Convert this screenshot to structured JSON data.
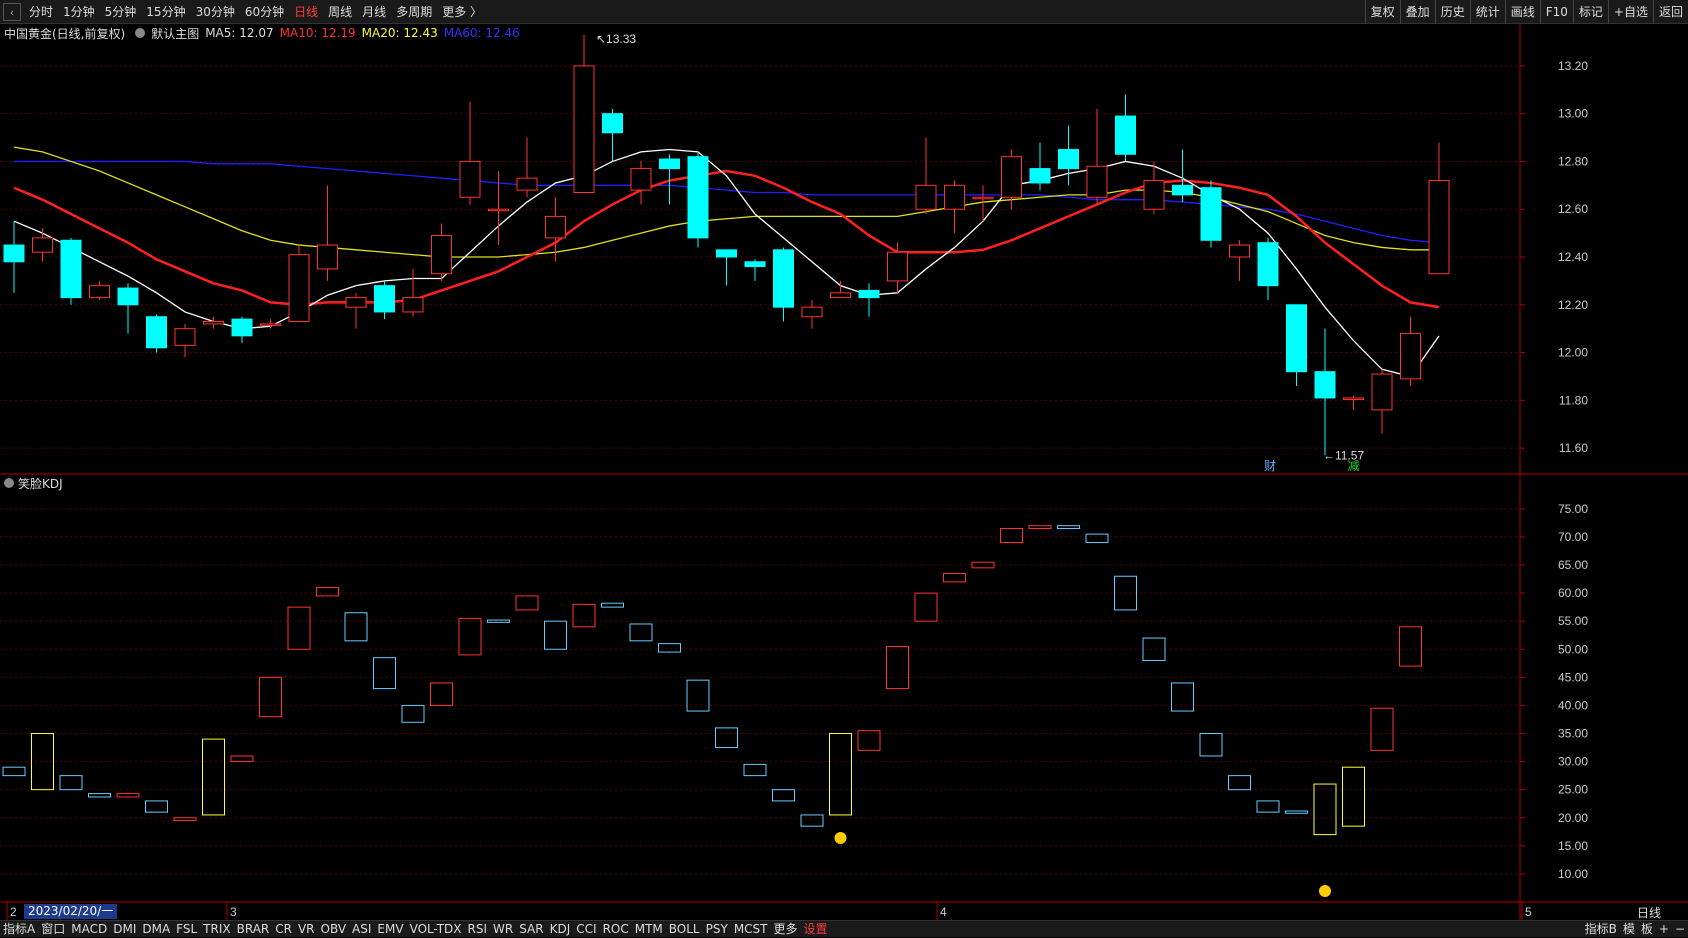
{
  "toolbar": {
    "back_icon": "back-arrow-icon",
    "periods": [
      "分时",
      "1分钟",
      "5分钟",
      "15分钟",
      "30分钟",
      "60分钟",
      "日线",
      "周线",
      "月线",
      "多周期",
      "更多 〉"
    ],
    "active_period": "日线",
    "right_buttons": [
      "复权",
      "叠加",
      "历史",
      "统计",
      "画线",
      "F10",
      "标记",
      "+自选",
      "返回"
    ]
  },
  "main_chart": {
    "title": "中国黄金(日线,前复权)",
    "template": "默认主图",
    "ma5": "MA5: 12.07",
    "ma10": "MA10: 12.19",
    "ma20": "MA20: 12.43",
    "ma60": "MA60: 12.46",
    "high_label": "13.33",
    "low_label": "11.57",
    "event_labels": [
      "财",
      "减"
    ]
  },
  "sub_chart": {
    "title": "笑脸KDJ"
  },
  "colors": {
    "up": "#ff3333",
    "down": "#00ffff",
    "ma5": "#ffffff",
    "ma10": "#ff2020",
    "ma20": "#e0e020",
    "ma60": "#2020ff",
    "yellow_box": "#ffff33",
    "blue_box": "#66ccff",
    "grid": "#8b0000"
  },
  "chart_data": [
    {
      "type": "candlestick",
      "title": "中国黄金(日线,前复权)",
      "ylim": [
        11.5,
        13.3
      ],
      "y_ticks": [
        "13.20",
        "13.00",
        "12.80",
        "12.60",
        "12.40",
        "12.20",
        "12.00",
        "11.80",
        "11.60"
      ],
      "x_labels": [
        "2",
        "3",
        "4",
        "5"
      ],
      "cursor_date": "2023/02/20/一",
      "candles": [
        [
          12.45,
          12.38,
          12.55,
          12.25
        ],
        [
          12.42,
          12.48,
          12.52,
          12.38
        ],
        [
          12.47,
          12.23,
          12.48,
          12.2
        ],
        [
          12.23,
          12.28,
          12.3,
          12.22
        ],
        [
          12.27,
          12.2,
          12.29,
          12.08
        ],
        [
          12.15,
          12.02,
          12.16,
          12.0
        ],
        [
          12.03,
          12.1,
          12.12,
          11.98
        ],
        [
          12.12,
          12.13,
          12.15,
          12.1
        ],
        [
          12.14,
          12.07,
          12.15,
          12.04
        ],
        [
          12.12,
          12.12,
          12.14,
          12.1
        ],
        [
          12.13,
          12.41,
          12.45,
          12.13
        ],
        [
          12.35,
          12.45,
          12.7,
          12.3
        ],
        [
          12.19,
          12.23,
          12.25,
          12.1
        ],
        [
          12.28,
          12.17,
          12.3,
          12.14
        ],
        [
          12.17,
          12.23,
          12.35,
          12.15
        ],
        [
          12.33,
          12.49,
          12.54,
          12.3
        ],
        [
          12.65,
          12.8,
          13.05,
          12.62
        ],
        [
          12.6,
          12.6,
          12.76,
          12.45
        ],
        [
          12.68,
          12.73,
          12.9,
          12.65
        ],
        [
          12.48,
          12.57,
          12.65,
          12.38
        ],
        [
          12.67,
          13.2,
          13.33,
          12.67
        ],
        [
          13.0,
          12.92,
          13.02,
          12.8
        ],
        [
          12.68,
          12.77,
          12.8,
          12.62
        ],
        [
          12.81,
          12.77,
          12.83,
          12.62
        ],
        [
          12.82,
          12.48,
          12.84,
          12.44
        ],
        [
          12.43,
          12.4,
          12.42,
          12.28
        ],
        [
          12.38,
          12.36,
          12.39,
          12.3
        ],
        [
          12.43,
          12.19,
          12.44,
          12.13
        ],
        [
          12.15,
          12.19,
          12.22,
          12.1
        ],
        [
          12.23,
          12.25,
          12.3,
          12.23
        ],
        [
          12.26,
          12.23,
          12.29,
          12.15
        ],
        [
          12.3,
          12.42,
          12.46,
          12.25
        ],
        [
          12.6,
          12.7,
          12.9,
          12.58
        ],
        [
          12.6,
          12.7,
          12.72,
          12.5
        ],
        [
          12.65,
          12.65,
          12.7,
          12.55
        ],
        [
          12.65,
          12.82,
          12.85,
          12.6
        ],
        [
          12.77,
          12.71,
          12.88,
          12.68
        ],
        [
          12.85,
          12.77,
          12.95,
          12.7
        ],
        [
          12.65,
          12.78,
          13.02,
          12.62
        ],
        [
          12.99,
          12.83,
          13.08,
          12.8
        ],
        [
          12.6,
          12.72,
          12.8,
          12.58
        ],
        [
          12.7,
          12.66,
          12.85,
          12.63
        ],
        [
          12.69,
          12.47,
          12.72,
          12.44
        ],
        [
          12.4,
          12.45,
          12.47,
          12.3
        ],
        [
          12.46,
          12.28,
          12.48,
          12.22
        ],
        [
          12.2,
          11.92,
          12.2,
          11.86
        ],
        [
          11.92,
          11.81,
          12.1,
          11.57
        ],
        [
          11.81,
          11.81,
          11.82,
          11.76
        ],
        [
          11.76,
          11.91,
          11.93,
          11.66
        ],
        [
          11.89,
          12.08,
          12.15,
          11.86
        ],
        [
          12.33,
          12.72,
          12.88,
          12.33
        ]
      ],
      "series": [
        {
          "name": "MA5",
          "values": [
            12.55,
            12.5,
            12.44,
            12.38,
            12.32,
            12.25,
            12.17,
            12.13,
            12.1,
            12.11,
            12.17,
            12.24,
            12.28,
            12.3,
            12.31,
            12.31,
            12.42,
            12.53,
            12.63,
            12.71,
            12.74,
            12.8,
            12.84,
            12.85,
            12.84,
            12.74,
            12.58,
            12.48,
            12.38,
            12.28,
            12.24,
            12.25,
            12.35,
            12.44,
            12.55,
            12.7,
            12.72,
            12.75,
            12.77,
            12.8,
            12.78,
            12.73,
            12.66,
            12.6,
            12.5,
            12.35,
            12.19,
            12.05,
            11.93,
            11.9,
            12.07
          ]
        },
        {
          "name": "MA10",
          "values": [
            12.69,
            12.64,
            12.58,
            12.52,
            12.46,
            12.39,
            12.34,
            12.29,
            12.26,
            12.21,
            12.2,
            12.21,
            12.21,
            12.21,
            12.22,
            12.26,
            12.3,
            12.34,
            12.4,
            12.46,
            12.55,
            12.62,
            12.68,
            12.72,
            12.74,
            12.76,
            12.74,
            12.69,
            12.63,
            12.58,
            12.49,
            12.42,
            12.42,
            12.42,
            12.43,
            12.47,
            12.52,
            12.57,
            12.62,
            12.67,
            12.71,
            12.72,
            12.71,
            12.69,
            12.66,
            12.57,
            12.46,
            12.37,
            12.28,
            12.21,
            12.19
          ]
        },
        {
          "name": "MA20",
          "values": [
            12.86,
            12.84,
            12.8,
            12.76,
            12.71,
            12.66,
            12.61,
            12.56,
            12.51,
            12.47,
            12.45,
            12.44,
            12.43,
            12.42,
            12.41,
            12.4,
            12.4,
            12.4,
            12.41,
            12.42,
            12.44,
            12.47,
            12.5,
            12.53,
            12.55,
            12.56,
            12.57,
            12.57,
            12.57,
            12.57,
            12.57,
            12.57,
            12.59,
            12.61,
            12.63,
            12.64,
            12.65,
            12.66,
            12.66,
            12.68,
            12.68,
            12.67,
            12.65,
            12.62,
            12.59,
            12.54,
            12.49,
            12.46,
            12.44,
            12.43,
            12.43
          ]
        },
        {
          "name": "MA60",
          "values": [
            12.8,
            12.8,
            12.8,
            12.8,
            12.8,
            12.8,
            12.8,
            12.79,
            12.79,
            12.79,
            12.78,
            12.77,
            12.76,
            12.75,
            12.74,
            12.73,
            12.72,
            12.71,
            12.7,
            12.7,
            12.7,
            12.7,
            12.7,
            12.7,
            12.69,
            12.68,
            12.67,
            12.67,
            12.66,
            12.66,
            12.66,
            12.66,
            12.66,
            12.66,
            12.66,
            12.66,
            12.66,
            12.65,
            12.64,
            12.64,
            12.64,
            12.63,
            12.62,
            12.61,
            12.6,
            12.58,
            12.55,
            12.52,
            12.49,
            12.47,
            12.46
          ]
        }
      ]
    },
    {
      "type": "bar",
      "title": "笑脸KDJ",
      "ylim": [
        5,
        78
      ],
      "y_ticks": [
        "75.00",
        "70.00",
        "65.00",
        "60.00",
        "55.00",
        "50.00",
        "45.00",
        "40.00",
        "35.00",
        "30.00",
        "25.00",
        "20.00",
        "15.00",
        "10.00"
      ],
      "boxes": [
        [
          27.5,
          29.0,
          "b"
        ],
        [
          25,
          35,
          "y"
        ],
        [
          25,
          27.5,
          "b"
        ],
        [
          23.7,
          24.3,
          "b"
        ],
        [
          23.7,
          24.3,
          "r"
        ],
        [
          21,
          23,
          "b"
        ],
        [
          19.5,
          20,
          "r"
        ],
        [
          20.5,
          34,
          "y"
        ],
        [
          30,
          31,
          "r"
        ],
        [
          38,
          45,
          "r"
        ],
        [
          50,
          57.5,
          "r"
        ],
        [
          59.5,
          61,
          "r"
        ],
        [
          51.5,
          56.5,
          "b"
        ],
        [
          43,
          48.5,
          "b"
        ],
        [
          37,
          40,
          "b"
        ],
        [
          40,
          44,
          "r"
        ],
        [
          49,
          55.5,
          "r"
        ],
        [
          54.8,
          55.2,
          "b"
        ],
        [
          57,
          59.5,
          "r"
        ],
        [
          50,
          55,
          "b"
        ],
        [
          54,
          58,
          "r"
        ],
        [
          57.5,
          58.2,
          "b"
        ],
        [
          51.5,
          54.5,
          "b"
        ],
        [
          49.5,
          51,
          "b"
        ],
        [
          39,
          44.5,
          "b"
        ],
        [
          32.5,
          36,
          "b"
        ],
        [
          27.5,
          29.5,
          "b"
        ],
        [
          23,
          25,
          "b"
        ],
        [
          18.5,
          20.5,
          "b"
        ],
        [
          20.5,
          35,
          "y"
        ],
        [
          32,
          35.5,
          "r"
        ],
        [
          43,
          50.5,
          "r"
        ],
        [
          55,
          60,
          "r"
        ],
        [
          62,
          63.5,
          "r"
        ],
        [
          64.5,
          65.5,
          "r"
        ],
        [
          69,
          71.5,
          "r"
        ],
        [
          71.5,
          72,
          "r"
        ],
        [
          71.5,
          72,
          "b"
        ],
        [
          69,
          70.5,
          "b"
        ],
        [
          57,
          63,
          "b"
        ],
        [
          48,
          52,
          "b"
        ],
        [
          39,
          44,
          "b"
        ],
        [
          31,
          35,
          "b"
        ],
        [
          25,
          27.5,
          "b"
        ],
        [
          21,
          23,
          "b"
        ],
        [
          20.8,
          21.2,
          "b"
        ],
        [
          17,
          26,
          "y"
        ],
        [
          18.5,
          29,
          "y"
        ],
        [
          32,
          39.5,
          "r"
        ],
        [
          47,
          54,
          "r"
        ]
      ],
      "smileys": [
        29,
        46
      ]
    }
  ],
  "bottom_tabs": [
    "指标A",
    "窗口",
    "MACD",
    "DMI",
    "DMA",
    "FSL",
    "TRIX",
    "BRAR",
    "CR",
    "VR",
    "OBV",
    "ASI",
    "EMV",
    "VOL-TDX",
    "RSI",
    "WR",
    "SAR",
    "KDJ",
    "CCI",
    "ROC",
    "MTM",
    "BOLL",
    "PSY",
    "MCST",
    "更多",
    "设置"
  ],
  "bottom_right": [
    "指标B",
    "模",
    "板",
    "+",
    "−"
  ],
  "period_label": "日线"
}
